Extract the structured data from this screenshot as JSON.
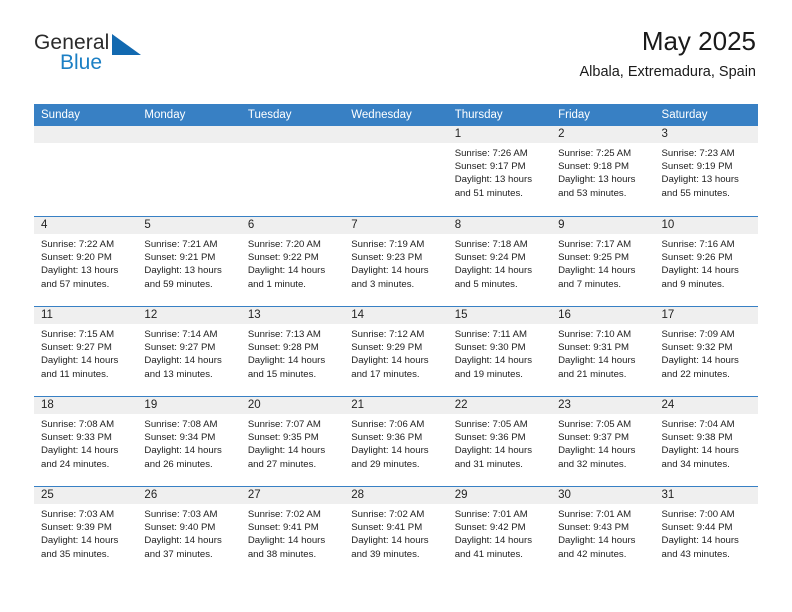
{
  "logo": {
    "word_top": "General",
    "word_bottom": "Blue",
    "triangle_color": "#1269b0"
  },
  "header": {
    "title": "May 2025",
    "subtitle": "Albala, Extremadura, Spain"
  },
  "theme": {
    "header_blue": "#3880c4",
    "daynum_band": "#efefef",
    "text": "#1d1d1d"
  },
  "weekdays": [
    "Sunday",
    "Monday",
    "Tuesday",
    "Wednesday",
    "Thursday",
    "Friday",
    "Saturday"
  ],
  "weeks": [
    [
      {
        "day": "",
        "empty": true
      },
      {
        "day": "",
        "empty": true
      },
      {
        "day": "",
        "empty": true
      },
      {
        "day": "",
        "empty": true
      },
      {
        "day": "1",
        "sunrise": "Sunrise: 7:26 AM",
        "sunset": "Sunset: 9:17 PM",
        "daylight": "Daylight: 13 hours and 51 minutes."
      },
      {
        "day": "2",
        "sunrise": "Sunrise: 7:25 AM",
        "sunset": "Sunset: 9:18 PM",
        "daylight": "Daylight: 13 hours and 53 minutes."
      },
      {
        "day": "3",
        "sunrise": "Sunrise: 7:23 AM",
        "sunset": "Sunset: 9:19 PM",
        "daylight": "Daylight: 13 hours and 55 minutes."
      }
    ],
    [
      {
        "day": "4",
        "sunrise": "Sunrise: 7:22 AM",
        "sunset": "Sunset: 9:20 PM",
        "daylight": "Daylight: 13 hours and 57 minutes."
      },
      {
        "day": "5",
        "sunrise": "Sunrise: 7:21 AM",
        "sunset": "Sunset: 9:21 PM",
        "daylight": "Daylight: 13 hours and 59 minutes."
      },
      {
        "day": "6",
        "sunrise": "Sunrise: 7:20 AM",
        "sunset": "Sunset: 9:22 PM",
        "daylight": "Daylight: 14 hours and 1 minute."
      },
      {
        "day": "7",
        "sunrise": "Sunrise: 7:19 AM",
        "sunset": "Sunset: 9:23 PM",
        "daylight": "Daylight: 14 hours and 3 minutes."
      },
      {
        "day": "8",
        "sunrise": "Sunrise: 7:18 AM",
        "sunset": "Sunset: 9:24 PM",
        "daylight": "Daylight: 14 hours and 5 minutes."
      },
      {
        "day": "9",
        "sunrise": "Sunrise: 7:17 AM",
        "sunset": "Sunset: 9:25 PM",
        "daylight": "Daylight: 14 hours and 7 minutes."
      },
      {
        "day": "10",
        "sunrise": "Sunrise: 7:16 AM",
        "sunset": "Sunset: 9:26 PM",
        "daylight": "Daylight: 14 hours and 9 minutes."
      }
    ],
    [
      {
        "day": "11",
        "sunrise": "Sunrise: 7:15 AM",
        "sunset": "Sunset: 9:27 PM",
        "daylight": "Daylight: 14 hours and 11 minutes."
      },
      {
        "day": "12",
        "sunrise": "Sunrise: 7:14 AM",
        "sunset": "Sunset: 9:27 PM",
        "daylight": "Daylight: 14 hours and 13 minutes."
      },
      {
        "day": "13",
        "sunrise": "Sunrise: 7:13 AM",
        "sunset": "Sunset: 9:28 PM",
        "daylight": "Daylight: 14 hours and 15 minutes."
      },
      {
        "day": "14",
        "sunrise": "Sunrise: 7:12 AM",
        "sunset": "Sunset: 9:29 PM",
        "daylight": "Daylight: 14 hours and 17 minutes."
      },
      {
        "day": "15",
        "sunrise": "Sunrise: 7:11 AM",
        "sunset": "Sunset: 9:30 PM",
        "daylight": "Daylight: 14 hours and 19 minutes."
      },
      {
        "day": "16",
        "sunrise": "Sunrise: 7:10 AM",
        "sunset": "Sunset: 9:31 PM",
        "daylight": "Daylight: 14 hours and 21 minutes."
      },
      {
        "day": "17",
        "sunrise": "Sunrise: 7:09 AM",
        "sunset": "Sunset: 9:32 PM",
        "daylight": "Daylight: 14 hours and 22 minutes."
      }
    ],
    [
      {
        "day": "18",
        "sunrise": "Sunrise: 7:08 AM",
        "sunset": "Sunset: 9:33 PM",
        "daylight": "Daylight: 14 hours and 24 minutes."
      },
      {
        "day": "19",
        "sunrise": "Sunrise: 7:08 AM",
        "sunset": "Sunset: 9:34 PM",
        "daylight": "Daylight: 14 hours and 26 minutes."
      },
      {
        "day": "20",
        "sunrise": "Sunrise: 7:07 AM",
        "sunset": "Sunset: 9:35 PM",
        "daylight": "Daylight: 14 hours and 27 minutes."
      },
      {
        "day": "21",
        "sunrise": "Sunrise: 7:06 AM",
        "sunset": "Sunset: 9:36 PM",
        "daylight": "Daylight: 14 hours and 29 minutes."
      },
      {
        "day": "22",
        "sunrise": "Sunrise: 7:05 AM",
        "sunset": "Sunset: 9:36 PM",
        "daylight": "Daylight: 14 hours and 31 minutes."
      },
      {
        "day": "23",
        "sunrise": "Sunrise: 7:05 AM",
        "sunset": "Sunset: 9:37 PM",
        "daylight": "Daylight: 14 hours and 32 minutes."
      },
      {
        "day": "24",
        "sunrise": "Sunrise: 7:04 AM",
        "sunset": "Sunset: 9:38 PM",
        "daylight": "Daylight: 14 hours and 34 minutes."
      }
    ],
    [
      {
        "day": "25",
        "sunrise": "Sunrise: 7:03 AM",
        "sunset": "Sunset: 9:39 PM",
        "daylight": "Daylight: 14 hours and 35 minutes."
      },
      {
        "day": "26",
        "sunrise": "Sunrise: 7:03 AM",
        "sunset": "Sunset: 9:40 PM",
        "daylight": "Daylight: 14 hours and 37 minutes."
      },
      {
        "day": "27",
        "sunrise": "Sunrise: 7:02 AM",
        "sunset": "Sunset: 9:41 PM",
        "daylight": "Daylight: 14 hours and 38 minutes."
      },
      {
        "day": "28",
        "sunrise": "Sunrise: 7:02 AM",
        "sunset": "Sunset: 9:41 PM",
        "daylight": "Daylight: 14 hours and 39 minutes."
      },
      {
        "day": "29",
        "sunrise": "Sunrise: 7:01 AM",
        "sunset": "Sunset: 9:42 PM",
        "daylight": "Daylight: 14 hours and 41 minutes."
      },
      {
        "day": "30",
        "sunrise": "Sunrise: 7:01 AM",
        "sunset": "Sunset: 9:43 PM",
        "daylight": "Daylight: 14 hours and 42 minutes."
      },
      {
        "day": "31",
        "sunrise": "Sunrise: 7:00 AM",
        "sunset": "Sunset: 9:44 PM",
        "daylight": "Daylight: 14 hours and 43 minutes."
      }
    ]
  ]
}
